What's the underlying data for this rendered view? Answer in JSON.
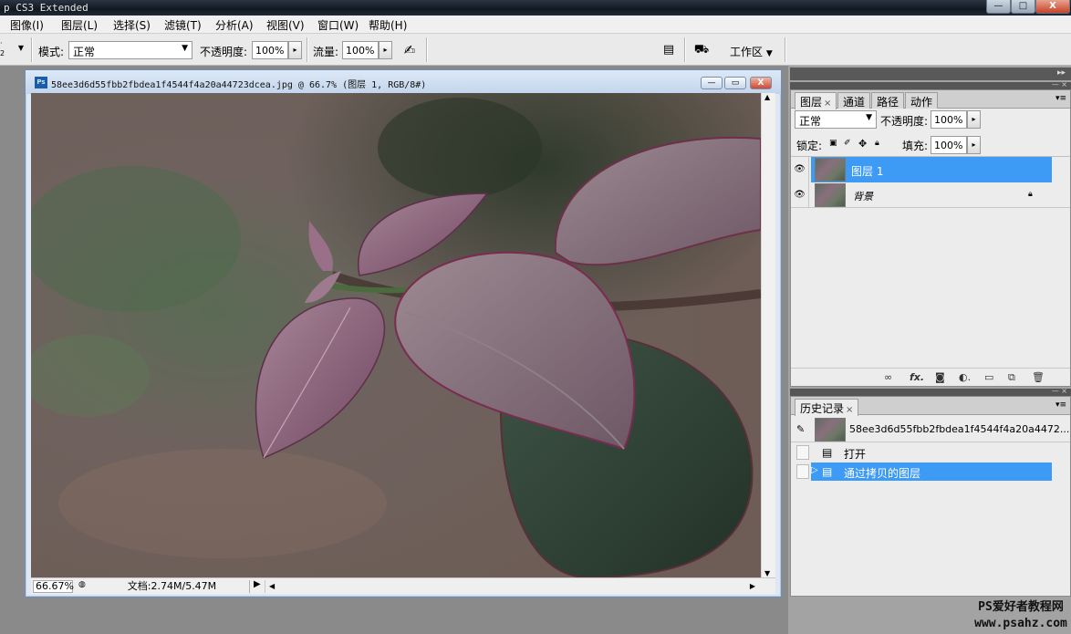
{
  "app": {
    "title": "p CS3 Extended",
    "window_controls": {
      "minimize": "—",
      "maximize": "□",
      "close": "X"
    }
  },
  "menu": [
    {
      "label": "图像(I)"
    },
    {
      "label": "图层(L)"
    },
    {
      "label": "选择(S)"
    },
    {
      "label": "滤镜(T)"
    },
    {
      "label": "分析(A)"
    },
    {
      "label": "视图(V)"
    },
    {
      "label": "窗口(W)"
    },
    {
      "label": "帮助(H)"
    }
  ],
  "options": {
    "brush_size": "2",
    "mode_label": "模式:",
    "mode_value": "正常",
    "opacity_label": "不透明度:",
    "opacity_value": "100%",
    "flow_label": "流量:",
    "flow_value": "100%",
    "workspace_label": "工作区"
  },
  "document": {
    "title": "58ee3d6d55fbb2fbdea1f4544f4a20a44723dcea.jpg @ 66.7% (图层 1, RGB/8#)",
    "zoom": "66.67%",
    "doc_size": "文档:2.74M/5.47M",
    "buttons": {
      "minimize": "—",
      "restore": "▭",
      "close": "X"
    }
  },
  "layers_panel": {
    "tabs": [
      "图层",
      "通道",
      "路径",
      "动作"
    ],
    "active_tab": "图层",
    "blend_mode": "正常",
    "opacity_label": "不透明度:",
    "opacity_value": "100%",
    "lock_label": "锁定:",
    "fill_label": "填充:",
    "fill_value": "100%",
    "layers": [
      {
        "name": "图层 1",
        "selected": true,
        "visible": true,
        "locked": false
      },
      {
        "name": "背景",
        "selected": false,
        "visible": true,
        "locked": true
      }
    ],
    "footer_icons": [
      "link-icon",
      "fx-icon",
      "mask-icon",
      "adjustment-icon",
      "group-icon",
      "new-layer-icon",
      "trash-icon"
    ]
  },
  "history_panel": {
    "tab": "历史记录",
    "snapshot": "58ee3d6d55fbb2fbdea1f4544f4a20a4472...",
    "items": [
      {
        "label": "打开",
        "selected": false
      },
      {
        "label": "通过拷贝的图层",
        "selected": true
      }
    ]
  },
  "watermark": {
    "line1": "PS爱好者教程网",
    "line2": "www.psahz.com"
  },
  "colors": {
    "selection": "#3d9af5",
    "panel_bg": "#ececec",
    "workspace_bg": "#8a8a8a"
  }
}
